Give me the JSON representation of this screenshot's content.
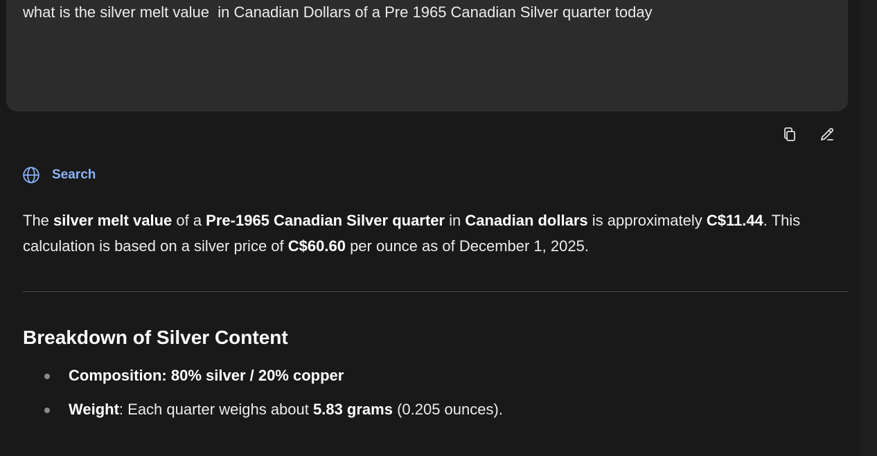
{
  "prompt": {
    "text": "what is the silver melt value  in Canadian Dollars of a Pre 1965 Canadian Silver quarter today"
  },
  "actions": {
    "copy_icon": "copy-icon",
    "edit_icon": "pencil-icon"
  },
  "search_chip": {
    "icon": "globe-icon",
    "label": "Search"
  },
  "answer": {
    "p1": "The ",
    "b1": "silver melt value",
    "p2": " of a ",
    "b2": "Pre-1965 Canadian Silver quarter",
    "p3": " in ",
    "b3": "Canadian dollars",
    "p4": " is approximately ",
    "b4": "C$11.44",
    "p5": ". This calculation is based on a silver price of ",
    "b5": "C$60.60",
    "p6": " per ounce as of December 1, 2025."
  },
  "section": {
    "title": "Breakdown of Silver Content"
  },
  "bullets": [
    {
      "bold": "Composition: 80% silver / 20% copper",
      "text": ""
    },
    {
      "bold": "Weight",
      "text": ": Each quarter weighs about ",
      "bold2": "5.83 grams",
      "text2": " (0.205 ounces)."
    }
  ],
  "colors": {
    "background": "#191919",
    "prompt_box": "#2c2c2c",
    "link_accent": "#8ab4f8"
  }
}
